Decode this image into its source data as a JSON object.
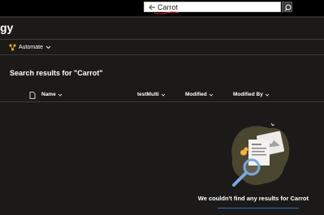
{
  "search": {
    "value": "Carrot",
    "accent": "#e81123"
  },
  "page": {
    "title": "gy"
  },
  "toolbar": {
    "automate_label": "Automate"
  },
  "results": {
    "heading": "Search results for \"Carrot\"",
    "columns": [
      "Name",
      "testMulti",
      "Modified",
      "Modified By"
    ]
  },
  "empty_state": {
    "message": "We couldn't find any results for Carrot"
  },
  "colors": {
    "background": "#1b1a19",
    "topbar": "#000000",
    "divider": "#3b3a39",
    "link": "#2f6fc0"
  }
}
